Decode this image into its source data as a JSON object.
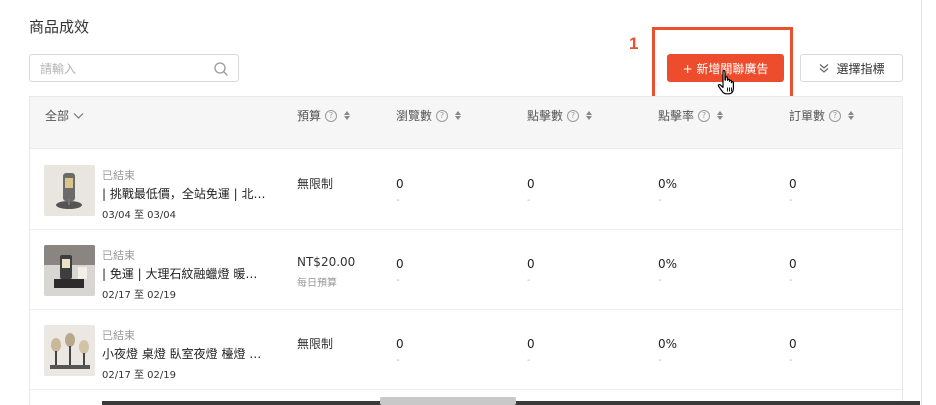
{
  "page": {
    "title": "商品成效"
  },
  "search": {
    "placeholder": "請輸入",
    "icon": "search-icon"
  },
  "annotation": {
    "number": "1",
    "color": "#e8502e"
  },
  "toolbar": {
    "add_label": "+ 新增關聯廣告",
    "select_metrics_label": "選擇指標",
    "accent": "#ee4d2d"
  },
  "table": {
    "columns": {
      "all": "全部",
      "budget": "預算",
      "views": "瀏覽數",
      "clicks": "點擊數",
      "ctr": "點擊率",
      "orders": "訂單數"
    },
    "rows": [
      {
        "status": "已結束",
        "name": "| 挑戰最低價，全站免運 | 北歐風 大理石",
        "dates": "03/04 至 03/04",
        "budget": "無限制",
        "budget_sub": "",
        "views": "0",
        "views_sub": "-",
        "clicks": "0",
        "clicks_sub": "-",
        "ctr": "0%",
        "ctr_sub": "-",
        "orders": "0",
        "orders_sub": "-"
      },
      {
        "status": "已結束",
        "name": "| 免運 | 大理石紋融蠟燈 暖光香氛",
        "dates": "02/17 至 02/19",
        "budget": "NT$20.00",
        "budget_sub": "每日預算",
        "views": "0",
        "views_sub": "-",
        "clicks": "0",
        "clicks_sub": "-",
        "ctr": "0%",
        "ctr_sub": "-",
        "orders": "0",
        "orders_sub": "-"
      },
      {
        "status": "已結束",
        "name": "小夜燈 桌燈 臥室夜燈 檯燈 床頭燈",
        "dates": "02/17 至 02/19",
        "budget": "無限制",
        "budget_sub": "",
        "views": "0",
        "views_sub": "-",
        "clicks": "0",
        "clicks_sub": "-",
        "ctr": "0%",
        "ctr_sub": "-",
        "orders": "0",
        "orders_sub": "-"
      }
    ]
  }
}
